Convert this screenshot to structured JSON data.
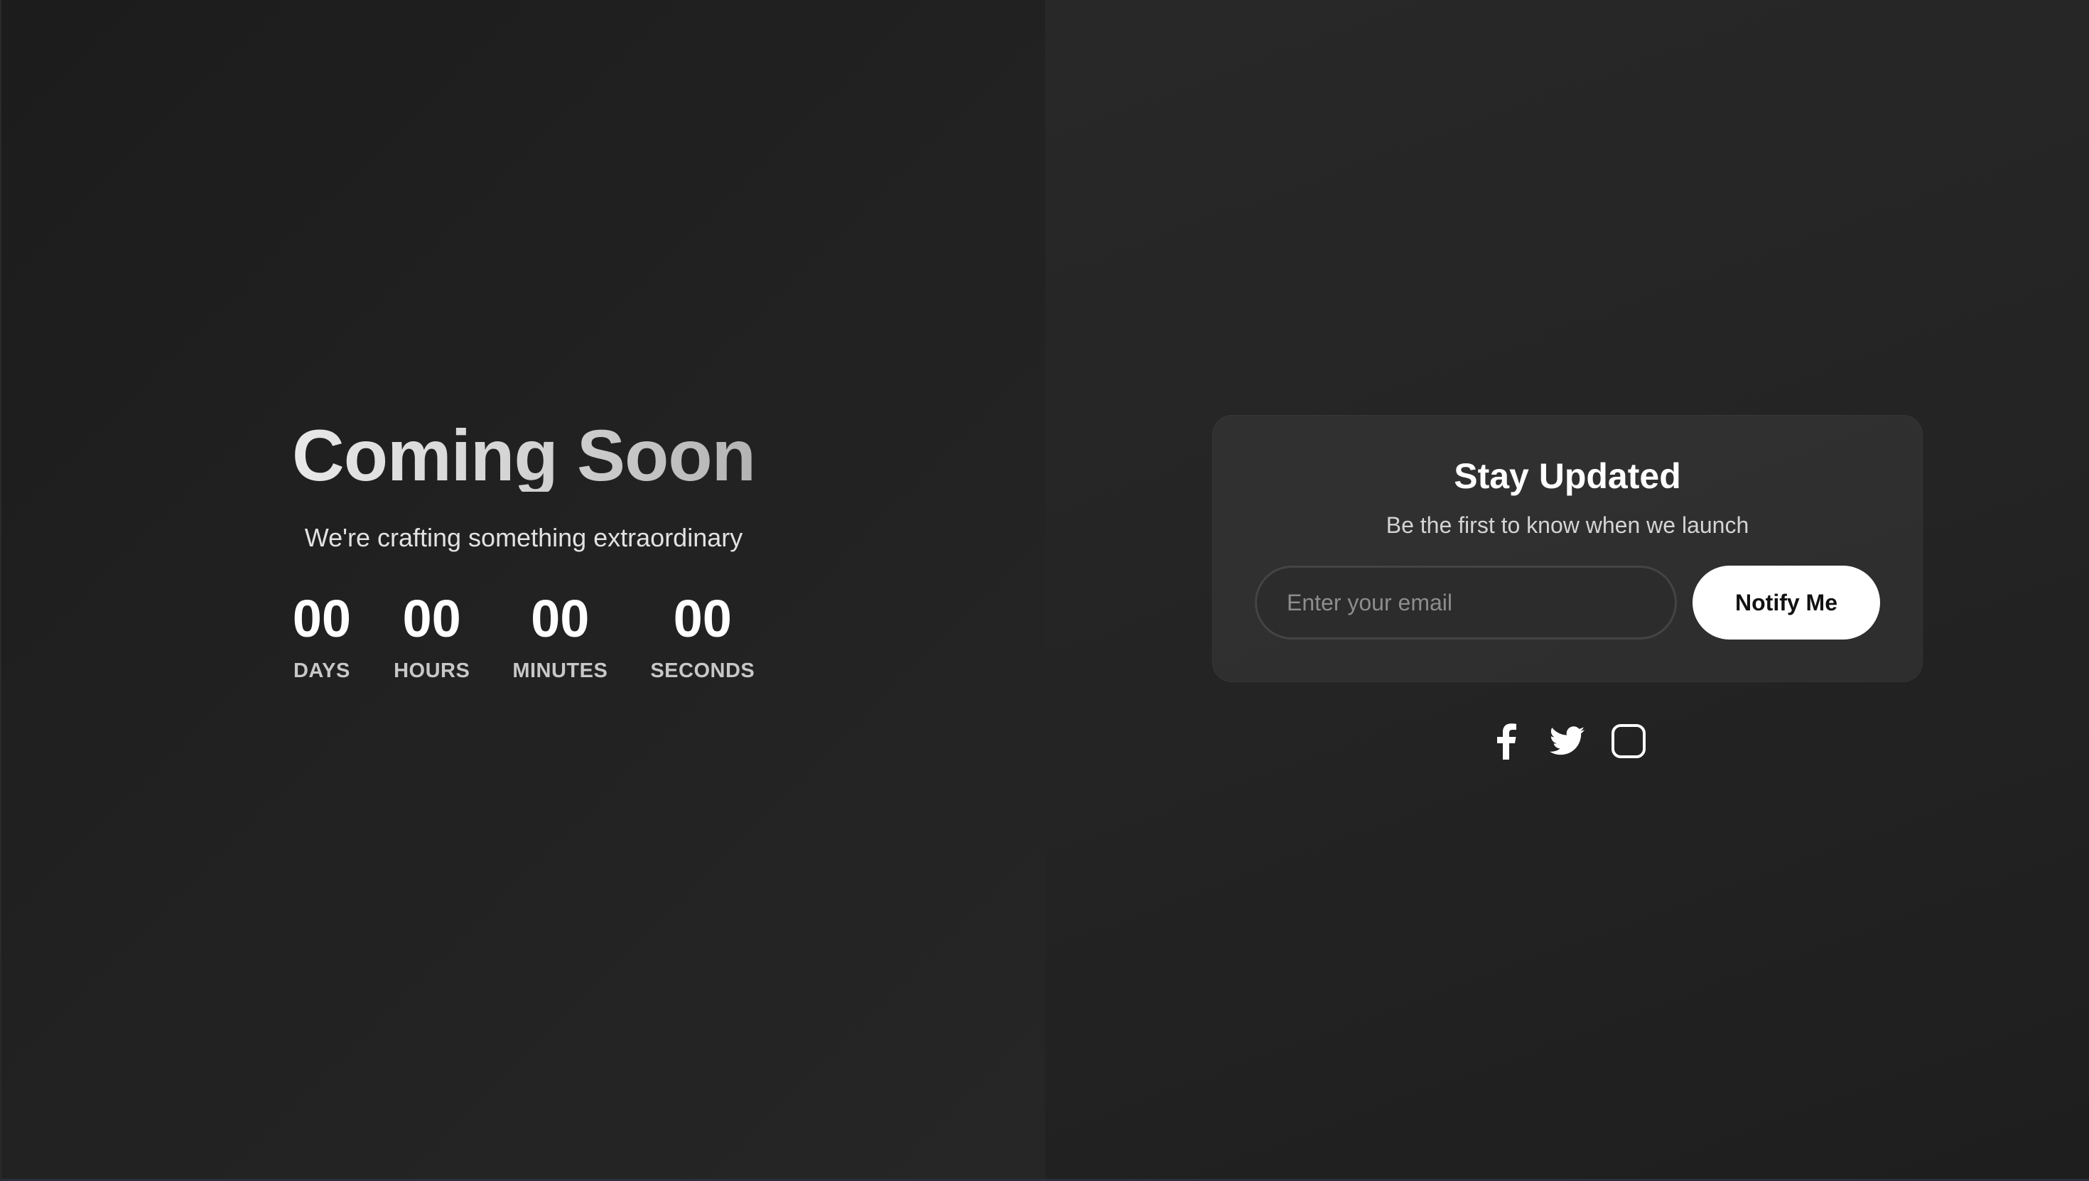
{
  "hero": {
    "title": "Coming Soon",
    "subtitle": "We're crafting something extraordinary"
  },
  "countdown": [
    {
      "value": "00",
      "label": "DAYS"
    },
    {
      "value": "00",
      "label": "HOURS"
    },
    {
      "value": "00",
      "label": "MINUTES"
    },
    {
      "value": "00",
      "label": "SECONDS"
    }
  ],
  "signup": {
    "title": "Stay Updated",
    "subtitle": "Be the first to know when we launch",
    "email_placeholder": "Enter your email",
    "email_value": "",
    "button_label": "Notify Me"
  },
  "socials": [
    {
      "icon": "facebook-icon"
    },
    {
      "icon": "twitter-icon"
    },
    {
      "icon": "instagram-icon"
    }
  ],
  "colors": {
    "background_left": "#1c1c1c",
    "background_right": "#262626",
    "text_primary": "#ffffff",
    "button_bg": "#ffffff",
    "button_text": "#111111"
  }
}
